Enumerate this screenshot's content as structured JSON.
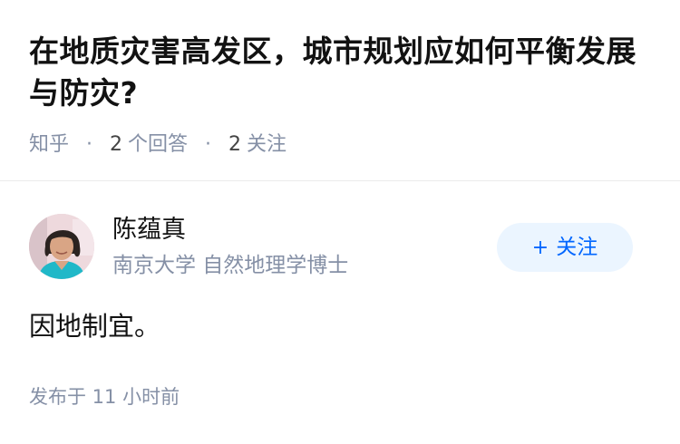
{
  "question": {
    "title": "在地质灾害高发区，城市规划应如何平衡发展与防灾?",
    "source": "知乎",
    "separator": "·",
    "answers_count": "2",
    "answers_label": "个回答",
    "followers_count": "2",
    "followers_label": "关注"
  },
  "answer": {
    "author": {
      "name": "陈蕴真",
      "bio": "南京大学 自然地理学博士",
      "avatar_icon": "avatar-photo-icon"
    },
    "follow_button": {
      "icon": "+",
      "label": "关注"
    },
    "content": "因地制宜。",
    "publish_time": "发布于 11 小时前"
  },
  "colors": {
    "title": "#121212",
    "meta": "#8590a6",
    "accent": "#0066ff",
    "follow_bg": "#ebf5ff",
    "divider": "#ebebeb"
  }
}
